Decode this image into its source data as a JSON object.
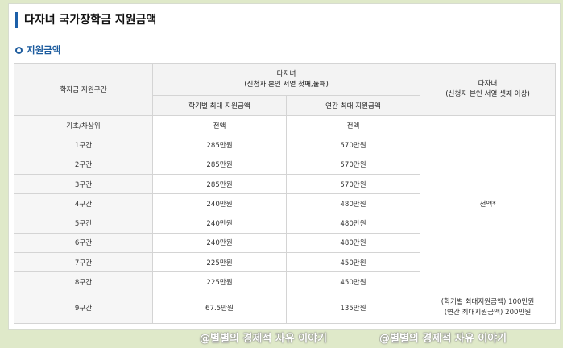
{
  "heading": "다자녀 국가장학금 지원금액",
  "subheading": "지원금액",
  "table": {
    "col_section": "학자금 지원구간",
    "group1_title": "다자녀",
    "group1_note": "(신청자 본인 서열 첫째,둘째)",
    "group1_sub1": "학기별 최대 지원금액",
    "group1_sub2": "연간 최대 지원금액",
    "group2_title": "다자녀",
    "group2_note": "(신청자 본인 서열 셋째 이상)",
    "group2_value": "전액*",
    "rows": [
      {
        "section": "기초/차상위",
        "semester": "전액",
        "annual": "전액"
      },
      {
        "section": "1구간",
        "semester": "285만원",
        "annual": "570만원"
      },
      {
        "section": "2구간",
        "semester": "285만원",
        "annual": "570만원"
      },
      {
        "section": "3구간",
        "semester": "285만원",
        "annual": "570만원"
      },
      {
        "section": "4구간",
        "semester": "240만원",
        "annual": "480만원"
      },
      {
        "section": "5구간",
        "semester": "240만원",
        "annual": "480만원"
      },
      {
        "section": "6구간",
        "semester": "240만원",
        "annual": "480만원"
      },
      {
        "section": "7구간",
        "semester": "225만원",
        "annual": "450만원"
      },
      {
        "section": "8구간",
        "semester": "225만원",
        "annual": "450만원"
      },
      {
        "section": "9구간",
        "semester": "67.5만원",
        "annual": "135만원",
        "third_line1": "(학기별 최대지원금액) 100만원",
        "third_line2": "(연간 최대지원금액) 200만원"
      }
    ]
  },
  "watermark": "@별별의 경제적 자유 이야기"
}
